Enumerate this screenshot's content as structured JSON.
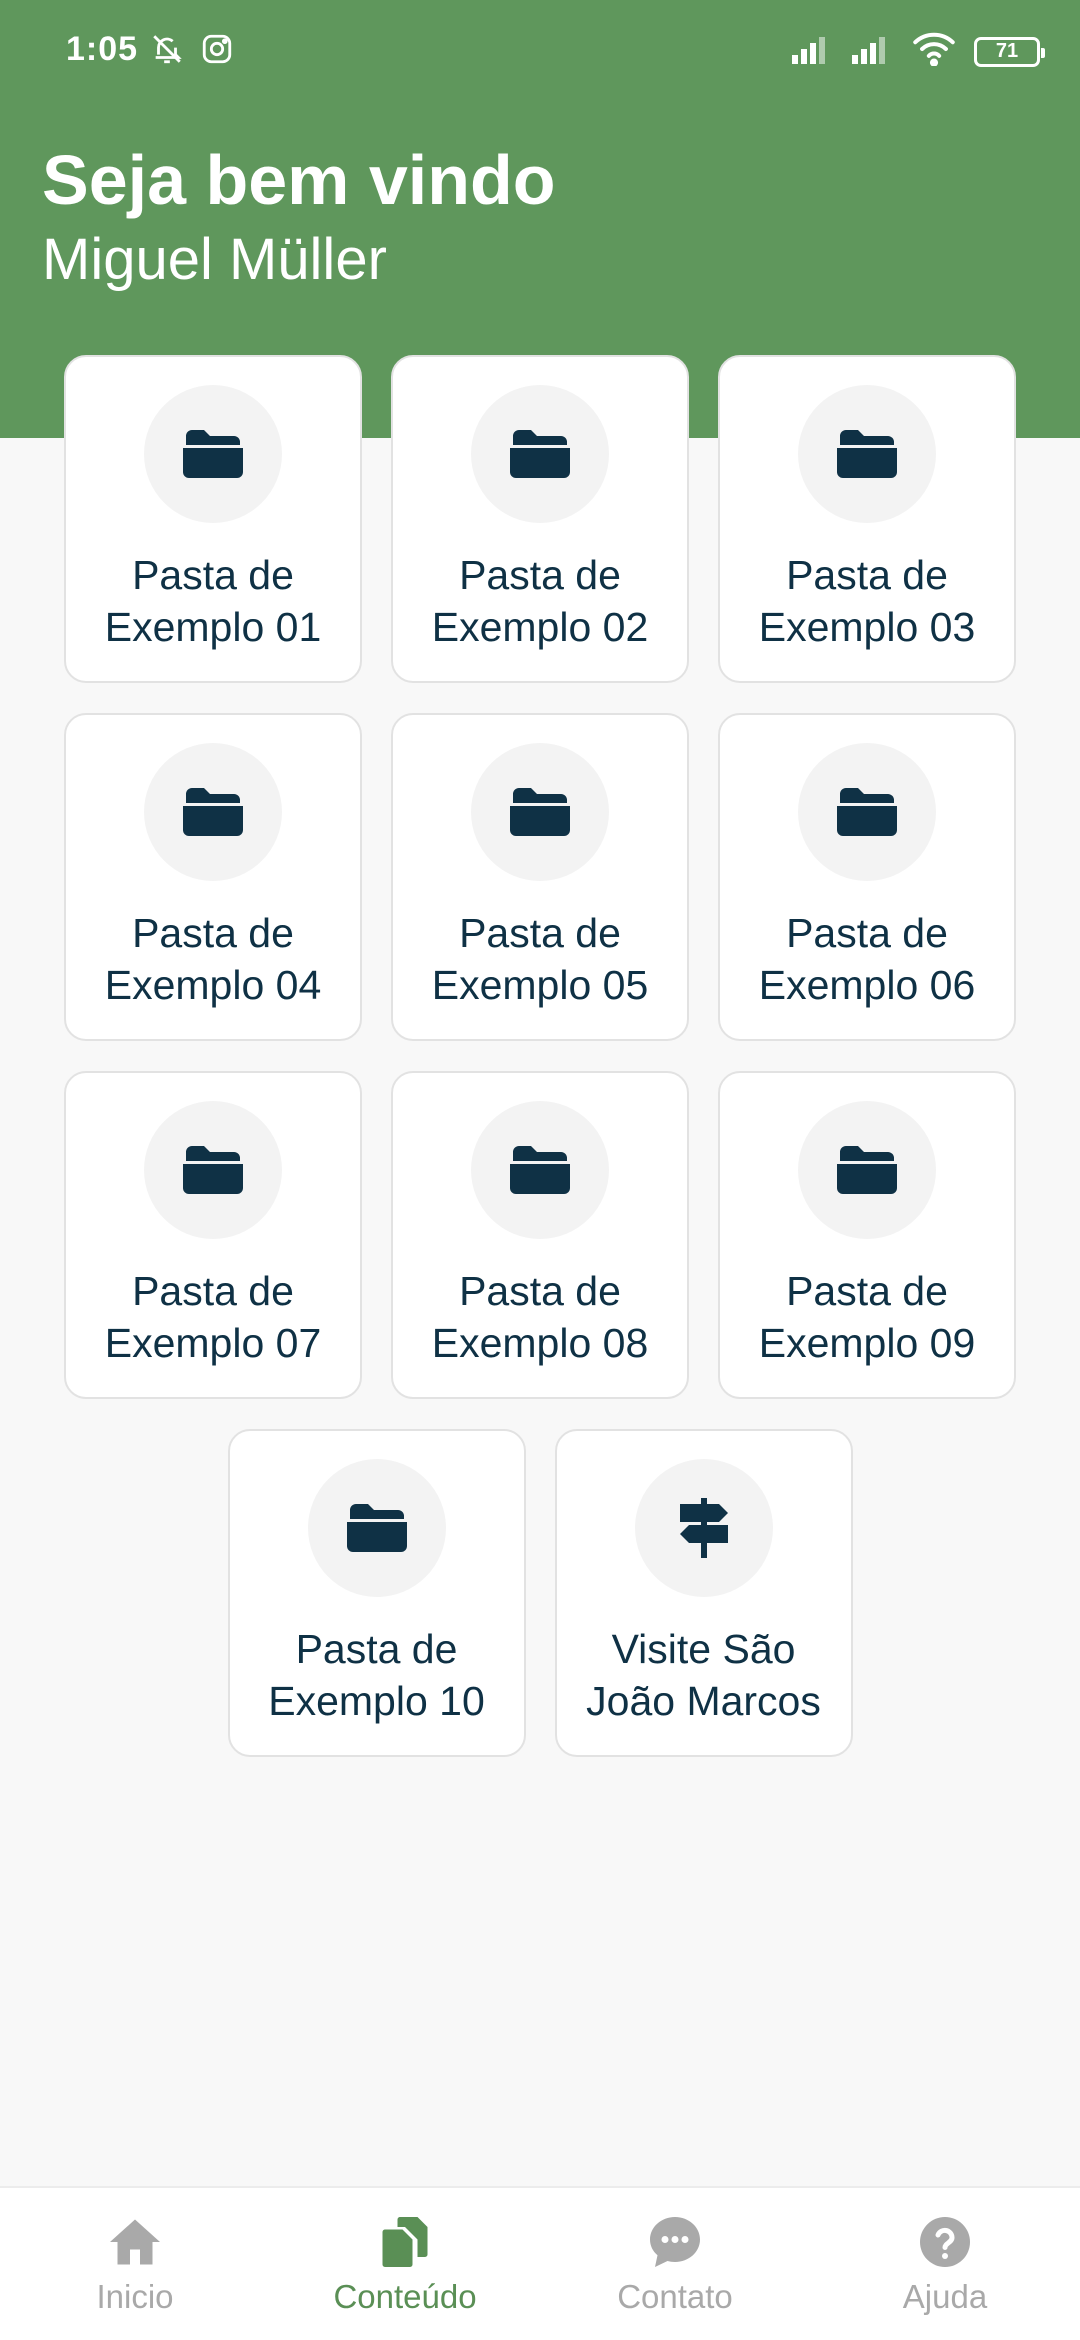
{
  "status": {
    "time": "1:05",
    "battery": "71"
  },
  "header": {
    "title": "Seja bem vindo",
    "user_name": "Miguel Müller"
  },
  "cards": [
    {
      "line1": "Pasta de",
      "line2": "Exemplo 01",
      "icon": "folder-icon"
    },
    {
      "line1": "Pasta de",
      "line2": "Exemplo 02",
      "icon": "folder-icon"
    },
    {
      "line1": "Pasta de",
      "line2": "Exemplo 03",
      "icon": "folder-icon"
    },
    {
      "line1": "Pasta de",
      "line2": "Exemplo 04",
      "icon": "folder-icon"
    },
    {
      "line1": "Pasta de",
      "line2": "Exemplo 05",
      "icon": "folder-icon"
    },
    {
      "line1": "Pasta de",
      "line2": "Exemplo 06",
      "icon": "folder-icon"
    },
    {
      "line1": "Pasta de",
      "line2": "Exemplo 07",
      "icon": "folder-icon"
    },
    {
      "line1": "Pasta de",
      "line2": "Exemplo 08",
      "icon": "folder-icon"
    },
    {
      "line1": "Pasta de",
      "line2": "Exemplo 09",
      "icon": "folder-icon"
    },
    {
      "line1": "Pasta de",
      "line2": "Exemplo 10",
      "icon": "folder-icon"
    },
    {
      "line1": "Visite São",
      "line2": "João Marcos",
      "icon": "signpost-icon"
    }
  ],
  "nav": {
    "items": [
      {
        "label": "Inicio",
        "icon": "home-icon"
      },
      {
        "label": "Conteúdo",
        "icon": "documents-icon"
      },
      {
        "label": "Contato",
        "icon": "chat-icon"
      },
      {
        "label": "Ajuda",
        "icon": "help-icon"
      }
    ],
    "active_index": 1
  },
  "colors": {
    "primary": "#5f975c",
    "icon_dark": "#0f3145",
    "nav_inactive": "#a9a9a9"
  }
}
